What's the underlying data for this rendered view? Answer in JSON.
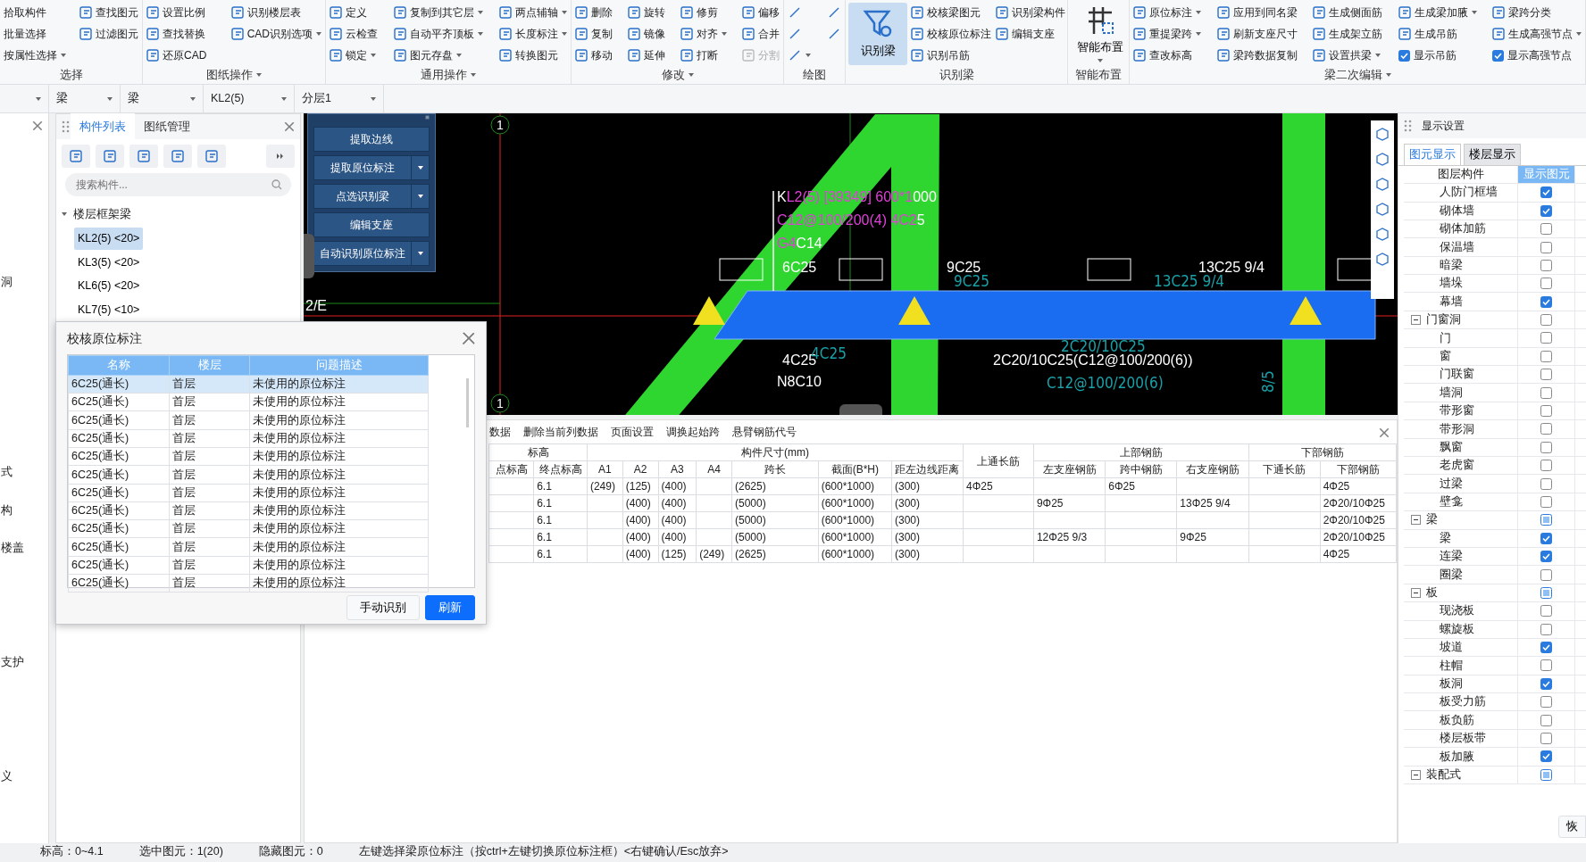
{
  "ribbon": {
    "groups": [
      {
        "title": "选择",
        "menu": false,
        "columns": [
          [
            {
              "label": "拾取构件",
              "kind": "button"
            },
            {
              "label": "批量选择",
              "kind": "button"
            },
            {
              "label": "按属性选择",
              "kind": "menu"
            }
          ],
          [
            {
              "label": "查找图元",
              "kind": "button"
            },
            {
              "label": "过滤图元",
              "kind": "button"
            }
          ]
        ]
      },
      {
        "title": "图纸操作",
        "menu": true,
        "columns": [
          [
            {
              "label": "设置比例",
              "kind": "button"
            },
            {
              "label": "查找替换",
              "kind": "button"
            },
            {
              "label": "还原CAD",
              "kind": "button"
            }
          ],
          [
            {
              "label": "识别楼层表",
              "kind": "button"
            },
            {
              "label": "CAD识别选项",
              "kind": "menu"
            }
          ]
        ]
      },
      {
        "title": "通用操作",
        "menu": true,
        "columns": [
          [
            {
              "label": "定义",
              "kind": "button"
            },
            {
              "label": "云检查",
              "kind": "button"
            },
            {
              "label": "锁定",
              "kind": "menu"
            }
          ],
          [
            {
              "label": "复制到其它层",
              "kind": "menu"
            },
            {
              "label": "自动平齐顶板",
              "kind": "menu"
            },
            {
              "label": "图元存盘",
              "kind": "menu"
            }
          ],
          [
            {
              "label": "两点辅轴",
              "kind": "menu"
            },
            {
              "label": "长度标注",
              "kind": "menu"
            },
            {
              "label": "转换图元",
              "kind": "button"
            }
          ]
        ]
      },
      {
        "title": "修改",
        "menu": true,
        "columns": [
          [
            {
              "label": "删除",
              "kind": "button"
            },
            {
              "label": "复制",
              "kind": "button"
            },
            {
              "label": "移动",
              "kind": "button"
            }
          ],
          [
            {
              "label": "旋转",
              "kind": "button"
            },
            {
              "label": "镜像",
              "kind": "button"
            },
            {
              "label": "延伸",
              "kind": "button"
            }
          ],
          [
            {
              "label": "修剪",
              "kind": "button"
            },
            {
              "label": "对齐",
              "kind": "menu"
            },
            {
              "label": "打断",
              "kind": "button"
            }
          ],
          [
            {
              "label": "偏移",
              "kind": "button"
            },
            {
              "label": "合并",
              "kind": "button"
            },
            {
              "label": "分割",
              "kind": "disabled"
            }
          ]
        ]
      },
      {
        "title": "绘图",
        "menu": false,
        "columns": [
          [
            {
              "kind": "icon"
            },
            {
              "kind": "icon"
            },
            {
              "kind": "icon-menu"
            }
          ],
          [
            {
              "kind": "icon"
            },
            {
              "kind": "icon"
            }
          ]
        ]
      },
      {
        "title": "识别梁",
        "menu": false,
        "columns": [
          [
            {
              "label": "识别梁",
              "kind": "large-active"
            }
          ],
          [
            {
              "label": "校核梁图元",
              "kind": "button"
            },
            {
              "label": "校核原位标注",
              "kind": "button"
            },
            {
              "label": "识别吊筋",
              "kind": "button"
            }
          ],
          [
            {
              "label": "识别梁构件",
              "kind": "button"
            },
            {
              "label": "编辑支座",
              "kind": "button"
            }
          ]
        ]
      },
      {
        "title": "智能布置",
        "menu": false,
        "columns": [
          [
            {
              "label": "智能布置",
              "kind": "large-menu"
            }
          ]
        ]
      },
      {
        "title": "梁二次编辑",
        "menu": true,
        "columns": [
          [
            {
              "label": "原位标注",
              "kind": "menu"
            },
            {
              "label": "重提梁跨",
              "kind": "menu"
            },
            {
              "label": "查改标高",
              "kind": "button"
            }
          ],
          [
            {
              "label": "应用到同名梁",
              "kind": "button"
            },
            {
              "label": "刷新支座尺寸",
              "kind": "button"
            },
            {
              "label": "梁跨数据复制",
              "kind": "button"
            }
          ],
          [
            {
              "label": "生成侧面筋",
              "kind": "button"
            },
            {
              "label": "生成架立筋",
              "kind": "button"
            },
            {
              "label": "设置拱梁",
              "kind": "menu"
            }
          ],
          [
            {
              "label": "生成梁加腋",
              "kind": "menu"
            },
            {
              "label": "生成吊筋",
              "kind": "button"
            },
            {
              "label": "显示吊筋",
              "kind": "check",
              "checked": true
            }
          ],
          [
            {
              "label": "梁跨分类",
              "kind": "button"
            },
            {
              "label": "生成高强节点",
              "kind": "menu"
            },
            {
              "label": "显示高强节点",
              "kind": "check",
              "checked": true
            }
          ]
        ]
      }
    ]
  },
  "selectors": [
    "梁",
    "梁",
    "KL2(5)",
    "分层1"
  ],
  "side_fragments": [
    "洞",
    "式",
    "构",
    "楼盖",
    "支护",
    "义"
  ],
  "component_panel": {
    "tabs": [
      {
        "label": "构件列表",
        "selected": true
      },
      {
        "label": "图纸管理",
        "selected": false
      }
    ],
    "search": {
      "placeholder": "搜索构件..."
    },
    "tree": [
      {
        "label": "楼层框架梁",
        "expanded": true,
        "children": [
          {
            "label": "KL2(5) <20>",
            "selected": true
          },
          {
            "label": "KL3(5) <20>",
            "selected": false
          },
          {
            "label": "KL6(5) <20>",
            "selected": false
          },
          {
            "label": "KL7(5) <10>",
            "selected": false
          }
        ]
      }
    ]
  },
  "float_panel": {
    "buttons": [
      {
        "label": "提取边线",
        "kind": "plain"
      },
      {
        "label": "提取原位标注",
        "kind": "split"
      },
      {
        "label": "点选识别梁",
        "kind": "split"
      },
      {
        "label": "编辑支座",
        "kind": "plain"
      },
      {
        "label": "自动识别原位标注",
        "kind": "split"
      }
    ]
  },
  "canvas": {
    "labels": [
      {
        "kind": "tag",
        "parts": [
          {
            "text": "K",
            "color": "#ffffff"
          },
          {
            "text": "L2(5) [39349] 600*1",
            "color": "#e040d8"
          },
          {
            "text": "000",
            "color": "#ffffff"
          }
        ]
      },
      {
        "kind": "tag",
        "parts": [
          {
            "text": "C12@100/200(4) 4C2",
            "color": "#e040d8"
          },
          {
            "text": "5",
            "color": "#ffffff"
          }
        ]
      },
      {
        "kind": "tag",
        "parts": [
          {
            "text": "G4",
            "color": "#e040d8"
          },
          {
            "text": "C14",
            "color": "#ffffff"
          }
        ]
      },
      {
        "kind": "tag",
        "parts": [
          {
            "text": "6C25",
            "color": "#ffffff"
          }
        ]
      },
      {
        "kind": "tag",
        "parts": [
          {
            "text": "9C25",
            "color": "#ffffff"
          }
        ]
      },
      {
        "kind": "tag",
        "parts": [
          {
            "text": "13C25 9/4",
            "color": "#ffffff"
          }
        ]
      },
      {
        "kind": "tag",
        "parts": [
          {
            "text": "4C25",
            "color": "#ffffff"
          }
        ]
      },
      {
        "kind": "tag",
        "parts": [
          {
            "text": "N8C10",
            "color": "#ffffff"
          }
        ]
      },
      {
        "kind": "tag",
        "parts": [
          {
            "text": "2C20/10C25(C12@100/200(6))",
            "color": "#ffffff"
          }
        ]
      },
      {
        "kind": "tag",
        "parts": [
          {
            "text": "2/E",
            "color": "#ffffff"
          }
        ]
      },
      {
        "kind": "cad",
        "parts": [
          {
            "text": "9C25",
            "color": "#1aa0a8"
          }
        ]
      },
      {
        "kind": "cad",
        "parts": [
          {
            "text": "13C25  9/4",
            "color": "#1aa0a8"
          }
        ]
      },
      {
        "kind": "cad",
        "parts": [
          {
            "text": "4C25",
            "color": "#1aa0a8"
          }
        ]
      },
      {
        "kind": "cad",
        "parts": [
          {
            "text": "2C20/10C25",
            "color": "#1aa0a8"
          }
        ]
      },
      {
        "kind": "cad",
        "parts": [
          {
            "text": "C12@100/200(6)",
            "color": "#1aa0a8"
          }
        ]
      },
      {
        "kind": "cad-vertical",
        "parts": [
          {
            "text": "8/5",
            "color": "#1aa0a8"
          }
        ]
      }
    ],
    "axes": [
      {
        "label": "1"
      },
      {
        "label": "1"
      }
    ]
  },
  "dialog": {
    "title": "校核原位标注",
    "columns": [
      "名称",
      "楼层",
      "问题描述"
    ],
    "rows": [
      {
        "cells": [
          "6C25(通长)",
          "首层",
          "未使用的原位标注"
        ],
        "selected": true
      },
      {
        "cells": [
          "6C25(通长)",
          "首层",
          "未使用的原位标注"
        ],
        "selected": false
      },
      {
        "cells": [
          "6C25(通长)",
          "首层",
          "未使用的原位标注"
        ],
        "selected": false
      },
      {
        "cells": [
          "6C25(通长)",
          "首层",
          "未使用的原位标注"
        ],
        "selected": false
      },
      {
        "cells": [
          "6C25(通长)",
          "首层",
          "未使用的原位标注"
        ],
        "selected": false
      },
      {
        "cells": [
          "6C25(通长)",
          "首层",
          "未使用的原位标注"
        ],
        "selected": false
      },
      {
        "cells": [
          "6C25(通长)",
          "首层",
          "未使用的原位标注"
        ],
        "selected": false
      },
      {
        "cells": [
          "6C25(通长)",
          "首层",
          "未使用的原位标注"
        ],
        "selected": false
      },
      {
        "cells": [
          "6C25(通长)",
          "首层",
          "未使用的原位标注"
        ],
        "selected": false
      },
      {
        "cells": [
          "6C25(通长)",
          "首层",
          "未使用的原位标注"
        ],
        "selected": false
      },
      {
        "cells": [
          "6C25(通长)",
          "首层",
          "未使用的原位标注"
        ],
        "selected": false
      },
      {
        "cells": [
          "6C25(通长)",
          "首层",
          "未使用的原位标注"
        ],
        "selected": false
      }
    ],
    "buttons": [
      {
        "label": "手动识别",
        "kind": "secondary"
      },
      {
        "label": "刷新",
        "kind": "primary"
      }
    ]
  },
  "span_table": {
    "toolbar": [
      "数据",
      "删除当前列数据",
      "页面设置",
      "调换起始跨",
      "悬臂钢筋代号"
    ],
    "groups": [
      {
        "label": "标高",
        "columns": [
          "点标高",
          "终点标高"
        ]
      },
      {
        "label": "构件尺寸(mm)",
        "columns": [
          "A1",
          "A2",
          "A3",
          "A4",
          "跨长",
          "截面(B*H)",
          "距左边线距离"
        ]
      },
      {
        "label": "上通长筋"
      },
      {
        "label": "上部钢筋",
        "columns": [
          "左支座钢筋",
          "跨中钢筋",
          "右支座钢筋"
        ]
      },
      {
        "label": "下部钢筋",
        "columns": [
          "下通长筋",
          "下部钢筋"
        ]
      }
    ],
    "rows": [
      [
        null,
        "6.1",
        "(249)",
        "(125)",
        "(400)",
        null,
        "(2625)",
        "(600*1000)",
        "(300)",
        "4Φ25",
        null,
        "6Φ25",
        null,
        null,
        "4Φ25"
      ],
      [
        null,
        "6.1",
        null,
        "(400)",
        "(400)",
        null,
        "(5000)",
        "(600*1000)",
        "(300)",
        null,
        "9Φ25",
        null,
        "13Φ25 9/4",
        null,
        "2Φ20/10Φ25"
      ],
      [
        null,
        "6.1",
        null,
        "(400)",
        "(400)",
        null,
        "(5000)",
        "(600*1000)",
        "(300)",
        null,
        null,
        null,
        null,
        null,
        "2Φ20/10Φ25"
      ],
      [
        null,
        "6.1",
        null,
        "(400)",
        "(400)",
        null,
        "(5000)",
        "(600*1000)",
        "(300)",
        null,
        "12Φ25 9/3",
        null,
        "9Φ25",
        null,
        "2Φ20/10Φ25"
      ],
      [
        null,
        "6.1",
        null,
        "(400)",
        "(125)",
        "(249)",
        "(2625)",
        "(600*1000)",
        "(300)",
        null,
        null,
        null,
        null,
        null,
        "4Φ25"
      ]
    ]
  },
  "display_panel": {
    "title": "显示设置",
    "tabs": [
      {
        "label": "图元显示",
        "selected": true
      },
      {
        "label": "楼层显示",
        "selected": false
      }
    ],
    "columns": [
      "图层构件",
      "显示图元"
    ],
    "tree": [
      {
        "children": [
          {
            "label": "人防门框墙",
            "checked": true
          },
          {
            "label": "砌体墙",
            "checked": true
          },
          {
            "label": "砌体加筋",
            "checked": false
          },
          {
            "label": "保温墙",
            "checked": false
          },
          {
            "label": "暗梁",
            "checked": false
          },
          {
            "label": "墙垛",
            "checked": false
          },
          {
            "label": "幕墙",
            "checked": true
          }
        ]
      },
      {
        "label": "门窗洞",
        "checked": false,
        "partial": false,
        "expanded": true,
        "children": [
          {
            "label": "门",
            "checked": false
          },
          {
            "label": "窗",
            "checked": false
          },
          {
            "label": "门联窗",
            "checked": false
          },
          {
            "label": "墙洞",
            "checked": false
          },
          {
            "label": "带形窗",
            "checked": false
          },
          {
            "label": "带形洞",
            "checked": false
          },
          {
            "label": "飘窗",
            "checked": false
          },
          {
            "label": "老虎窗",
            "checked": false
          },
          {
            "label": "过梁",
            "checked": false
          },
          {
            "label": "壁龛",
            "checked": false
          }
        ]
      },
      {
        "label": "梁",
        "checked": false,
        "partial": true,
        "expanded": true,
        "children": [
          {
            "label": "梁",
            "checked": true
          },
          {
            "label": "连梁",
            "checked": true
          },
          {
            "label": "圈梁",
            "checked": false
          }
        ]
      },
      {
        "label": "板",
        "checked": false,
        "partial": true,
        "expanded": true,
        "children": [
          {
            "label": "现浇板",
            "checked": false
          },
          {
            "label": "螺旋板",
            "checked": false
          },
          {
            "label": "坡道",
            "checked": true
          },
          {
            "label": "柱帽",
            "checked": false
          },
          {
            "label": "板洞",
            "checked": true
          },
          {
            "label": "板受力筋",
            "checked": false
          },
          {
            "label": "板负筋",
            "checked": false
          },
          {
            "label": "楼层板带",
            "checked": false
          },
          {
            "label": "板加腋",
            "checked": true
          }
        ]
      },
      {
        "label": "装配式",
        "checked": false,
        "partial": true,
        "expanded": true
      }
    ],
    "restore": "恢"
  },
  "status_bar": [
    "标高：0~4.1",
    "选中图元：1(20)",
    "隐藏图元：0",
    "左键选择梁原位标注（按ctrl+左键切换原位标注框）<右键确认/Esc放弃>"
  ]
}
